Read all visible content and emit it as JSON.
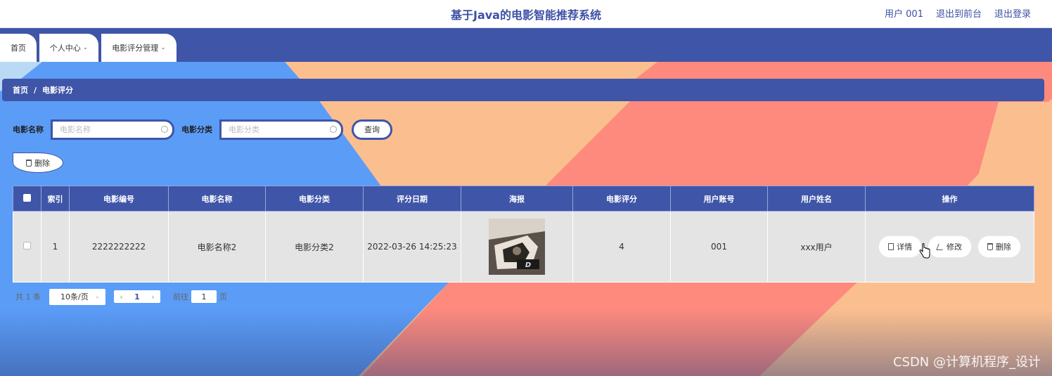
{
  "header": {
    "title": "基于Java的电影智能推荐系统",
    "user": "用户 001",
    "front_link": "退出到前台",
    "logout": "退出登录"
  },
  "nav": {
    "tabs": [
      {
        "label": "首页"
      },
      {
        "label": "个人中心"
      },
      {
        "label": "电影评分管理"
      }
    ]
  },
  "breadcrumb": {
    "home": "首页",
    "separator": "/",
    "current": "电影评分"
  },
  "search": {
    "name_label": "电影名称",
    "name_placeholder": "电影名称",
    "category_label": "电影分类",
    "category_placeholder": "电影分类",
    "query_label": "查询"
  },
  "toolbar": {
    "delete_label": "删除"
  },
  "table": {
    "headers": [
      "索引",
      "电影编号",
      "电影名称",
      "电影分类",
      "评分日期",
      "海报",
      "电影评分",
      "用户账号",
      "用户姓名",
      "操作"
    ],
    "rows": [
      {
        "index": "1",
        "movie_id": "2222222222",
        "movie_name": "电影名称2",
        "category": "电影分类2",
        "date": "2022-03-26 14:25:23",
        "rating": "4",
        "account": "001",
        "user_name": "xxx用户"
      }
    ],
    "actions": {
      "detail": "详情",
      "edit": "修改",
      "delete": "删除"
    }
  },
  "pagination": {
    "total": "共 1 条",
    "page_size": "10条/页",
    "current_page": "1",
    "goto_prefix": "前往",
    "goto_value": "1",
    "goto_suffix": "页"
  },
  "watermark": "CSDN @计算机程序_设计",
  "colors": {
    "primary": "#3f55a8",
    "bg_blue": "#5b9cf7",
    "bg_peach": "#fbbf8f",
    "bg_coral": "#fd8a7d"
  }
}
